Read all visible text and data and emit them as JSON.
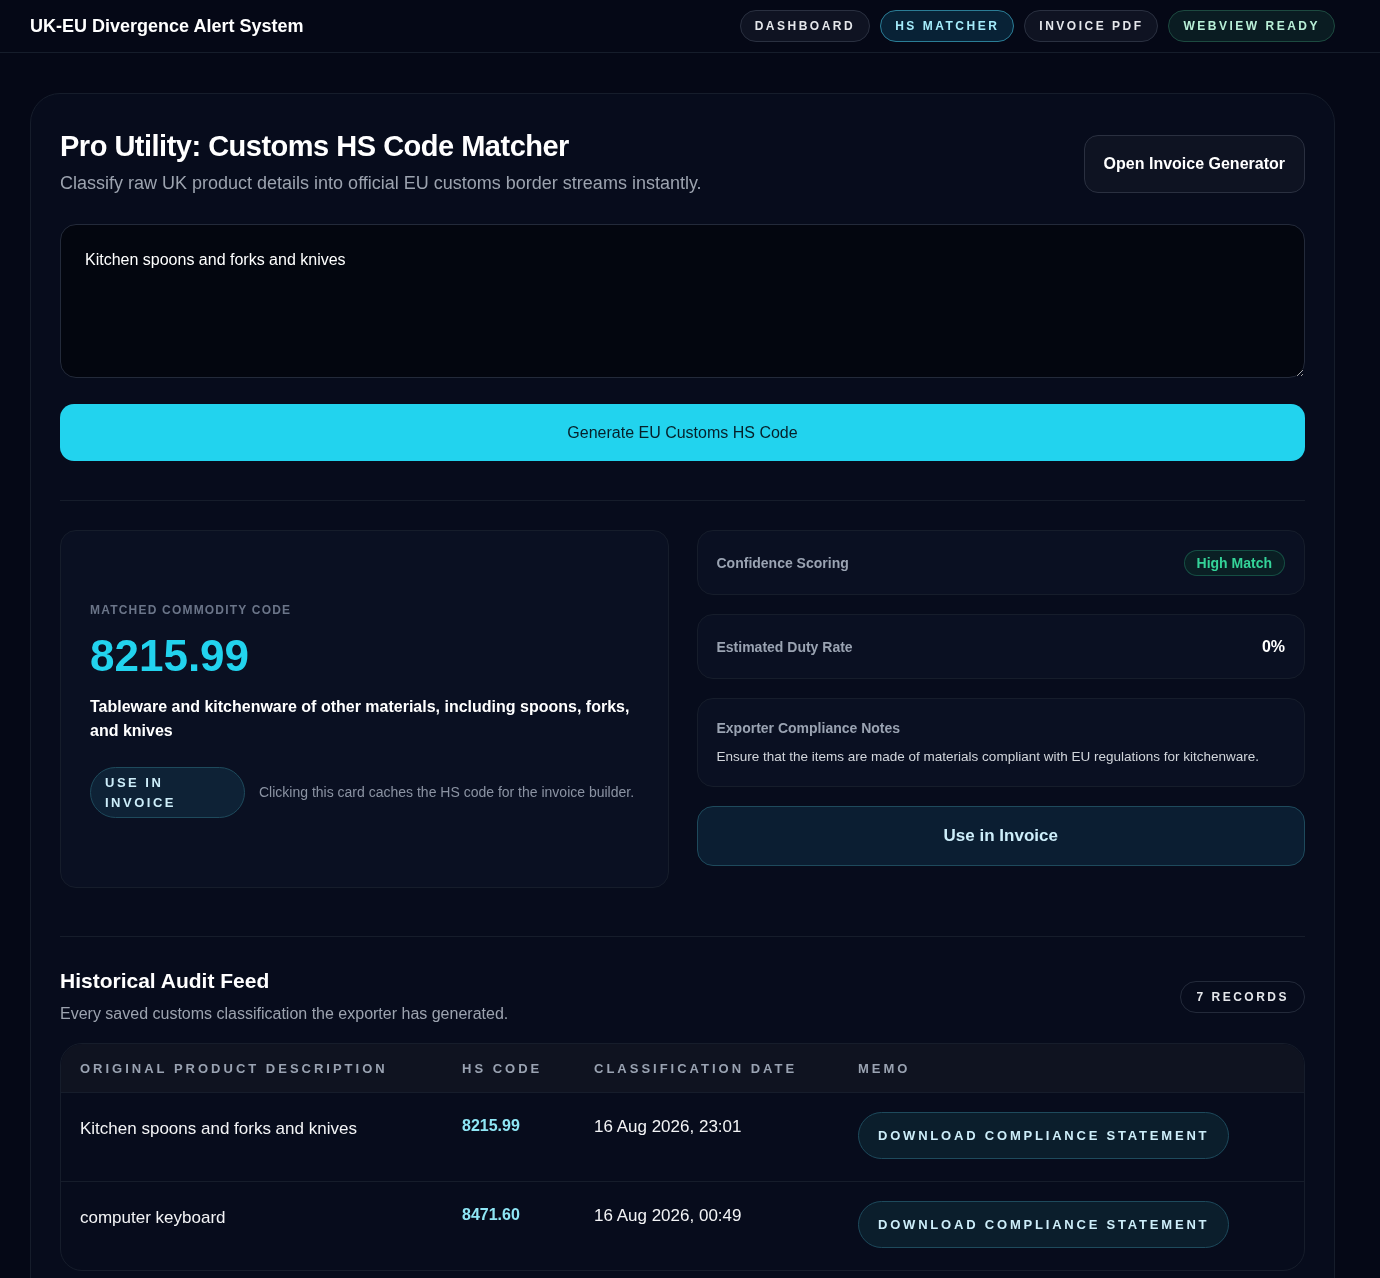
{
  "header": {
    "title": "UK-EU Divergence Alert System",
    "nav": [
      {
        "label": "DASHBOARD",
        "kind": "tab",
        "selected": false
      },
      {
        "label": "HS MATCHER",
        "kind": "tab",
        "selected": true
      },
      {
        "label": "INVOICE PDF",
        "kind": "tab",
        "selected": false
      },
      {
        "label": "WEBVIEW READY",
        "kind": "status"
      }
    ]
  },
  "matcher": {
    "title": "Pro Utility: Customs HS Code Matcher",
    "subtitle": "Classify raw UK product details into official EU customs border streams instantly.",
    "open_button": "Open Invoice Generator",
    "input": {
      "value": "Kitchen spoons and forks and knives"
    },
    "generate_button": "Generate EU Customs HS Code"
  },
  "result": {
    "label": "MATCHED COMMODITY CODE",
    "code": "8215.99",
    "description": "Tableware and kitchenware of other materials, including spoons, forks, and knives",
    "use_button": "USE IN INVOICE",
    "hint": "Clicking this card caches the HS code for the invoice builder.",
    "confidence": {
      "label": "Confidence Scoring",
      "badge": "High Match",
      "color": "#34d399"
    },
    "duty": {
      "label": "Estimated Duty Rate",
      "value": "0%"
    },
    "notes": {
      "label": "Exporter Compliance Notes",
      "text": "Ensure that the items are made of materials compliant with EU regulations for kitchenware."
    },
    "invoice_button": "Use in Invoice"
  },
  "audit": {
    "title": "Historical Audit Feed",
    "subtitle": "Every saved customs classification the exporter has generated.",
    "count": "7 RECORDS",
    "columns": [
      "ORIGINAL PRODUCT DESCRIPTION",
      "HS CODE",
      "CLASSIFICATION DATE",
      "MEMO"
    ],
    "rows": [
      {
        "description": "Kitchen spoons and forks and knives",
        "code": "8215.99",
        "date": "16 Aug 2026, 23:01",
        "action": "DOWNLOAD COMPLIANCE STATEMENT"
      },
      {
        "description": "computer keyboard",
        "code": "8471.60",
        "date": "16 Aug 2026, 00:49",
        "action": "DOWNLOAD COMPLIANCE STATEMENT"
      }
    ]
  }
}
